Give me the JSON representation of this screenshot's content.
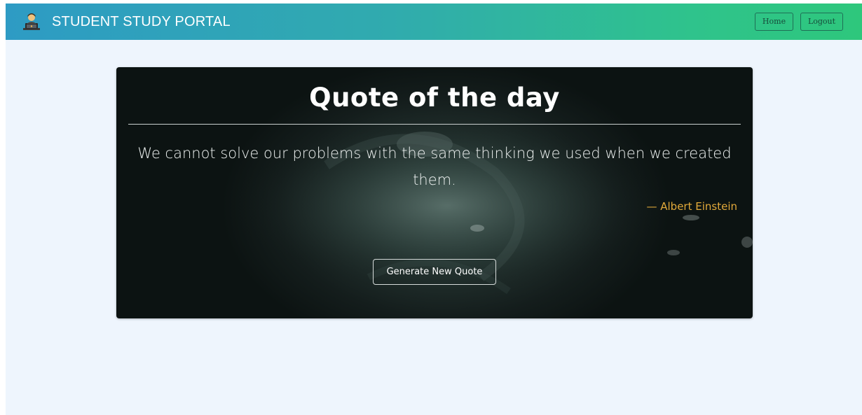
{
  "navbar": {
    "brand_icon": "student-at-laptop-icon",
    "brand_title": "STUDENT STUDY PORTAL",
    "home_label": "Home",
    "logout_label": "Logout",
    "gradient_colors": [
      "#2e9bc4",
      "#2ec77c"
    ]
  },
  "quote_card": {
    "title": "Quote of the day",
    "quote": "We cannot solve our problems with the same thinking we used when we created them.",
    "author": "— Albert Einstein",
    "generate_label": "Generate New Quote",
    "author_color": "#e2a93a"
  },
  "page": {
    "background_color": "#eef5fd"
  }
}
